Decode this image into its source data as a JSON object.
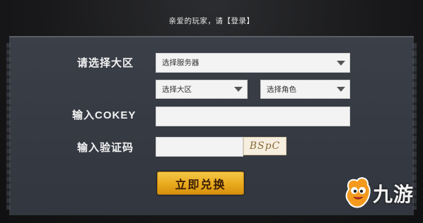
{
  "header": {
    "notice": "亲爱的玩家，请【登录】"
  },
  "form": {
    "region_label": "请选择大区",
    "server_select": {
      "value": "选择服务器"
    },
    "region_select": {
      "value": "选择大区"
    },
    "role_select": {
      "value": "选择角色"
    },
    "cokey_label": "输入COKEY",
    "cokey_input": {
      "value": ""
    },
    "captcha_label": "输入验证码",
    "captcha_input": {
      "value": ""
    },
    "captcha_image_text": "BSpC",
    "redeem_button": "立即兑换"
  },
  "watermark": {
    "text": "九游",
    "icon": "mascot-icon"
  },
  "colors": {
    "panel": "#3a3e47",
    "button": "#f0b730",
    "button_text": "#3a1d05"
  }
}
